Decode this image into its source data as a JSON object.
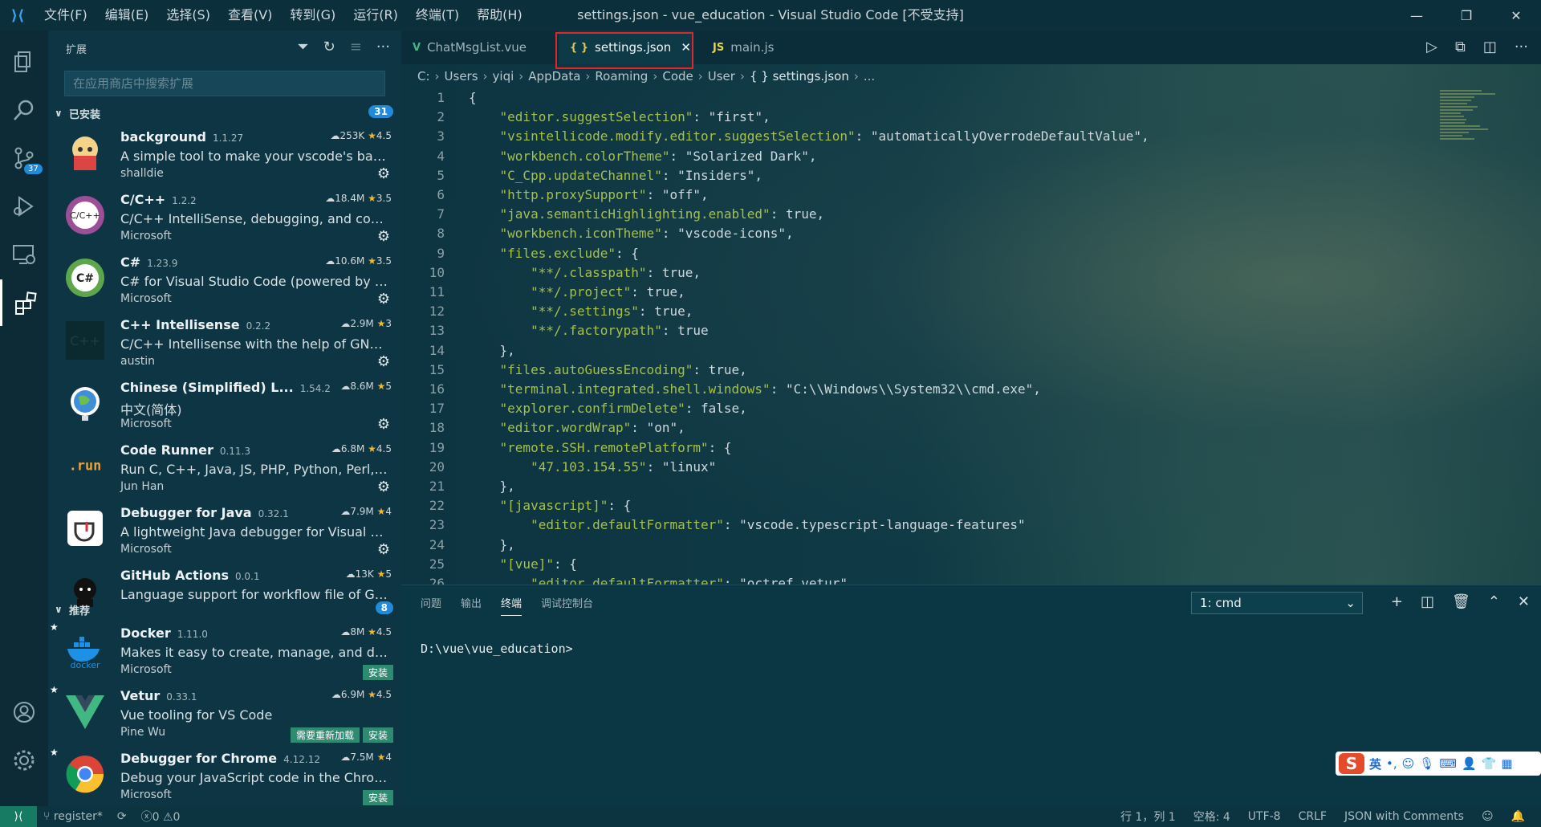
{
  "titlebar": {
    "menus": [
      "文件(F)",
      "编辑(E)",
      "选择(S)",
      "查看(V)",
      "转到(G)",
      "运行(R)",
      "终端(T)",
      "帮助(H)"
    ],
    "title": "settings.json - vue_education - Visual Studio Code [不受支持]"
  },
  "activity": {
    "scm_badge": "37"
  },
  "sidebar": {
    "header": "扩展",
    "search_placeholder": "在应用商店中搜索扩展",
    "installed": {
      "label": "已安装",
      "count": "31",
      "items": [
        {
          "name": "background",
          "version": "1.1.27",
          "downloads": "253K",
          "rating": "4.5",
          "desc": "A simple tool to make your vscode's backgro...",
          "publisher": "shalldie",
          "icon": "anime-avatar-icon"
        },
        {
          "name": "C/C++",
          "version": "1.2.2",
          "downloads": "18.4M",
          "rating": "3.5",
          "desc": "C/C++ IntelliSense, debugging, and code br...",
          "publisher": "Microsoft",
          "icon": "cpp-icon"
        },
        {
          "name": "C#",
          "version": "1.23.9",
          "downloads": "10.6M",
          "rating": "3.5",
          "desc": "C# for Visual Studio Code (powered by Omni...",
          "publisher": "Microsoft",
          "icon": "csharp-icon"
        },
        {
          "name": "C++ Intellisense",
          "version": "0.2.2",
          "downloads": "2.9M",
          "rating": "3",
          "desc": "C/C++ Intellisense with the help of GNU Glo...",
          "publisher": "austin",
          "icon": "cpp-intellisense-icon"
        },
        {
          "name": "Chinese (Simplified) L...",
          "version": "1.54.2",
          "downloads": "8.6M",
          "rating": "5",
          "desc": "中文(简体)",
          "publisher": "Microsoft",
          "icon": "globe-icon"
        },
        {
          "name": "Code Runner",
          "version": "0.11.3",
          "downloads": "6.8M",
          "rating": "4.5",
          "desc": "Run C, C++, Java, JS, PHP, Python, Perl, Ruby,...",
          "publisher": "Jun Han",
          "icon": "run-icon"
        },
        {
          "name": "Debugger for Java",
          "version": "0.32.1",
          "downloads": "7.9M",
          "rating": "4",
          "desc": "A lightweight Java debugger for Visual Studi...",
          "publisher": "Microsoft",
          "icon": "java-debugger-icon"
        },
        {
          "name": "GitHub Actions",
          "version": "0.0.1",
          "downloads": "13K",
          "rating": "5",
          "desc": "Language support for workflow file of GitHu...",
          "publisher": "",
          "icon": "github-icon"
        }
      ]
    },
    "recommended": {
      "label": "推荐",
      "count": "8",
      "items": [
        {
          "name": "Docker",
          "version": "1.11.0",
          "downloads": "8M",
          "rating": "4.5",
          "desc": "Makes it easy to create, manage, and debug ...",
          "publisher": "Microsoft",
          "buttons": [
            "安装"
          ],
          "icon": "docker-icon"
        },
        {
          "name": "Vetur",
          "version": "0.33.1",
          "downloads": "6.9M",
          "rating": "4.5",
          "desc": "Vue tooling for VS Code",
          "publisher": "Pine Wu",
          "buttons": [
            "需要重新加载",
            "安装"
          ],
          "icon": "vue-icon"
        },
        {
          "name": "Debugger for Chrome",
          "version": "4.12.12",
          "downloads": "7.5M",
          "rating": "4",
          "desc": "Debug your JavaScript code in the Chrome b...",
          "publisher": "Microsoft",
          "buttons": [
            "安装"
          ],
          "icon": "chrome-icon"
        }
      ]
    }
  },
  "editor": {
    "tabs": [
      {
        "label": "ChatMsgList.vue",
        "icon": "V"
      },
      {
        "label": "settings.json",
        "icon": "{ }"
      },
      {
        "label": "main.js",
        "icon": "JS"
      }
    ],
    "breadcrumb": [
      "C:",
      "Users",
      "yiqi",
      "AppData",
      "Roaming",
      "Code",
      "User",
      "{ } settings.json",
      "..."
    ],
    "lines": [
      "{",
      "    \"editor.suggestSelection\": \"first\",",
      "    \"vsintellicode.modify.editor.suggestSelection\": \"automaticallyOverrodeDefaultValue\",",
      "    \"workbench.colorTheme\": \"Solarized Dark\",",
      "    \"C_Cpp.updateChannel\": \"Insiders\",",
      "    \"http.proxySupport\": \"off\",",
      "    \"java.semanticHighlighting.enabled\": true,",
      "    \"workbench.iconTheme\": \"vscode-icons\",",
      "    \"files.exclude\": {",
      "        \"**/.classpath\": true,",
      "        \"**/.project\": true,",
      "        \"**/.settings\": true,",
      "        \"**/.factorypath\": true",
      "    },",
      "    \"files.autoGuessEncoding\": true,",
      "    \"terminal.integrated.shell.windows\": \"C:\\\\Windows\\\\System32\\\\cmd.exe\",",
      "    \"explorer.confirmDelete\": false,",
      "    \"editor.wordWrap\": \"on\",",
      "    \"remote.SSH.remotePlatform\": {",
      "        \"47.103.154.55\": \"linux\"",
      "    },",
      "    \"[javascript]\": {",
      "        \"editor.defaultFormatter\": \"vscode.typescript-language-features\"",
      "    },",
      "    \"[vue]\": {",
      "        \"editor.defaultFormatter\": \"octref.vetur\""
    ]
  },
  "panel": {
    "tabs": [
      "问题",
      "输出",
      "终端",
      "调试控制台"
    ],
    "active_tab": "终端",
    "terminal_select": "1: cmd",
    "terminal_text": "D:\\vue\\vue_education>"
  },
  "ime": {
    "mode": "英"
  },
  "statusbar": {
    "branch": "register*",
    "errors": "0",
    "warnings": "0",
    "position": "行 1，列 1",
    "spaces": "空格: 4",
    "encoding": "UTF-8",
    "eol": "CRLF",
    "language": "JSON with Comments"
  }
}
